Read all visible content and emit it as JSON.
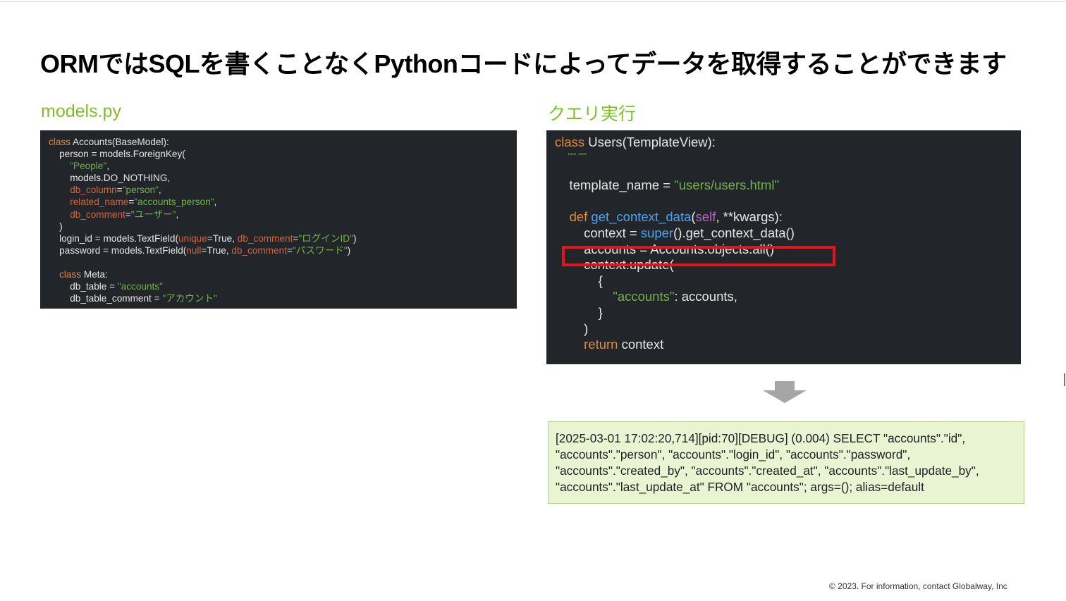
{
  "title": "ORMではSQLを書くことなくPythonコードによってデータを取得することができます",
  "left_panel": {
    "heading": "models.py",
    "code": {
      "l1_kw": "class",
      "l1_rest": " Accounts(BaseModel):",
      "l2": "    person = models.ForeignKey(",
      "l3_str": "\"People\"",
      "l3_rest": ",",
      "l4": "        models.DO_NOTHING,",
      "l5_arg": "db_column",
      "l5_eq": "=",
      "l5_str": "\"person\"",
      "l5_rest": ",",
      "l6_arg": "related_name",
      "l6_eq": "=",
      "l6_str": "\"accounts_person\"",
      "l6_rest": ",",
      "l7_arg": "db_comment",
      "l7_eq": "=",
      "l7_str": "\"ユーザー\"",
      "l7_rest": ",",
      "l8": "    )",
      "l9_a": "    login_id = models.TextField(",
      "l9_arg1": "unique",
      "l9_b": "=True, ",
      "l9_arg2": "db_comment",
      "l9_c": "=",
      "l9_str": "\"ログインID\"",
      "l9_d": ")",
      "l10_a": "    password = models.TextField(",
      "l10_arg1": "null",
      "l10_b": "=True, ",
      "l10_arg2": "db_comment",
      "l10_c": "=",
      "l10_str": "\"パスワード\"",
      "l10_d": ")",
      "l12_kw": "class",
      "l12_rest": " Meta:",
      "l13_a": "        db_table = ",
      "l13_str": "\"accounts\"",
      "l14_a": "        db_table_comment = ",
      "l14_str": "\"アカウント\""
    }
  },
  "right_panel": {
    "heading": "クエリ実行",
    "code": {
      "l1_kw": "class",
      "l1_rest": " Users(TemplateView):",
      "l2_str": "\"\"\" \"\"\"",
      "l4_a": "    template_name = ",
      "l4_str": "\"users/users.html\"",
      "l6_kw": "def",
      "l6_fn": "get_context_data",
      "l6_p1": "(",
      "l6_self": "self",
      "l6_p2": ", **kwargs):",
      "l7_a": "        context = ",
      "l7_fn": "super",
      "l7_b": "().get_context_data()",
      "l8": "        accounts = Accounts.objects.all()",
      "l9": "        context.update(",
      "l10": "            {",
      "l11_str": "\"accounts\"",
      "l11_rest": ": accounts,",
      "l12": "            }",
      "l13": "        )",
      "l14_kw": "return",
      "l14_rest": " context"
    }
  },
  "sql_log": {
    "line1": "[2025-03-01 17:02:20,714][pid:70][DEBUG] (0.004) SELECT \"accounts\".\"id\",",
    "line2": "\"accounts\".\"person\", \"accounts\".\"login_id\", \"accounts\".\"password\",",
    "line3": "\"accounts\".\"created_by\", \"accounts\".\"created_at\", \"accounts\".\"last_update_by\",",
    "line4": "\"accounts\".\"last_update_at\" FROM \"accounts\"; args=(); alias=default"
  },
  "footer": "© 2023. For information, contact Globalway, Inc",
  "colors": {
    "heading_green": "#7fbf2a",
    "code_bg": "#22252a",
    "highlight_red": "#e3141c",
    "sql_bg": "#e9f4d3"
  },
  "icons": {
    "arrow": "down-arrow-icon"
  }
}
